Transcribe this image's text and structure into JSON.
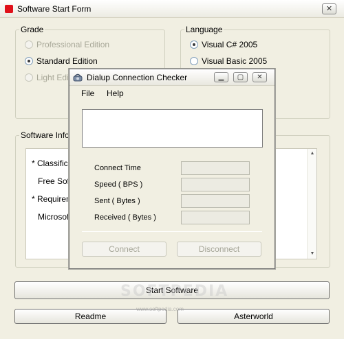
{
  "main_window": {
    "title": "Software Start Form",
    "close_glyph": "✕"
  },
  "grade": {
    "label": "Grade",
    "options": [
      {
        "label": "Professional Edition",
        "checked": false,
        "enabled": false
      },
      {
        "label": "Standard Edition",
        "checked": true,
        "enabled": true
      },
      {
        "label": "Light Edit",
        "checked": false,
        "enabled": false
      }
    ]
  },
  "language": {
    "label": "Language",
    "options": [
      {
        "label": "Visual C# 2005",
        "checked": true
      },
      {
        "label": "Visual Basic 2005",
        "checked": false
      }
    ]
  },
  "info": {
    "label": "Software Inform",
    "lines": [
      "* Classificat",
      "Free Softw",
      "* Requireme",
      "Microsoft"
    ]
  },
  "buttons": {
    "start": "Start Software",
    "readme": "Readme",
    "asterworld": "Asterworld"
  },
  "watermark": {
    "text": "SOFTPEDIA",
    "url": "www.softpedia.com"
  },
  "dialog": {
    "title": "Dialup Connection Checker",
    "menu": [
      "File",
      "Help"
    ],
    "fields": [
      {
        "label": "Connect Time",
        "value": ""
      },
      {
        "label": "Speed ( BPS )",
        "value": ""
      },
      {
        "label": "Sent ( Bytes )",
        "value": ""
      },
      {
        "label": "Received ( Bytes )",
        "value": ""
      }
    ],
    "connect_label": "Connect",
    "disconnect_label": "Disconnect",
    "minimize_glyph": "▁",
    "maximize_glyph": "▢",
    "close_glyph": "✕"
  },
  "colors": {
    "window_bg": "#f1efe2",
    "app_icon": "#e0101a"
  }
}
